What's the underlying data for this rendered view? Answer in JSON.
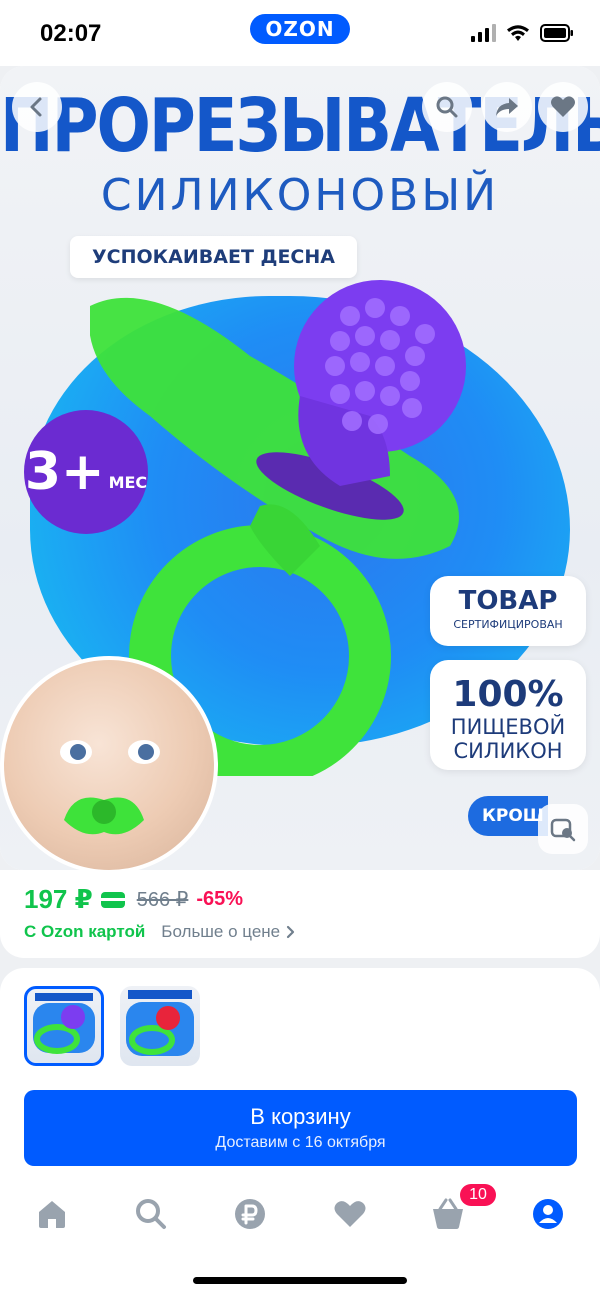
{
  "status_bar": {
    "time": "02:07",
    "logo": "OZON"
  },
  "product_image": {
    "title": "ПРОРЕЗЫВАТЕЛЬ",
    "subtitle": "СИЛИКОНОВЫЙ",
    "tag": "УСПОКАИВАЕТ ДЕСНА",
    "age_number": "3+",
    "age_unit": "МЕС",
    "info_certified_big": "ТОВАР",
    "info_certified_small": "СЕРТИФИЦИРОВАН",
    "info_silicone_big": "100%",
    "info_silicone_line1": "ПИЩЕВОЙ",
    "info_silicone_line2": "СИЛИКОН",
    "brand": "КРОШ"
  },
  "price": {
    "current": "197 ₽",
    "old": "566 ₽",
    "discount": "-65%",
    "ozon_card_label": "С Ozon картой",
    "more_about_price": "Больше о цене"
  },
  "gallery": {
    "thumbnails": [
      "thumb-1",
      "thumb-2"
    ],
    "selected_index": 0
  },
  "cart_button": {
    "label": "В корзину",
    "delivery": "Доставим с 16 октября"
  },
  "tabbar": {
    "items": [
      "home-icon",
      "search-icon",
      "ruble-icon",
      "heart-icon",
      "cart-icon",
      "profile-icon"
    ],
    "cart_badge": "10"
  },
  "colors": {
    "accent": "#005bff",
    "price_green": "#10c44c",
    "discount_pink": "#f91155"
  }
}
